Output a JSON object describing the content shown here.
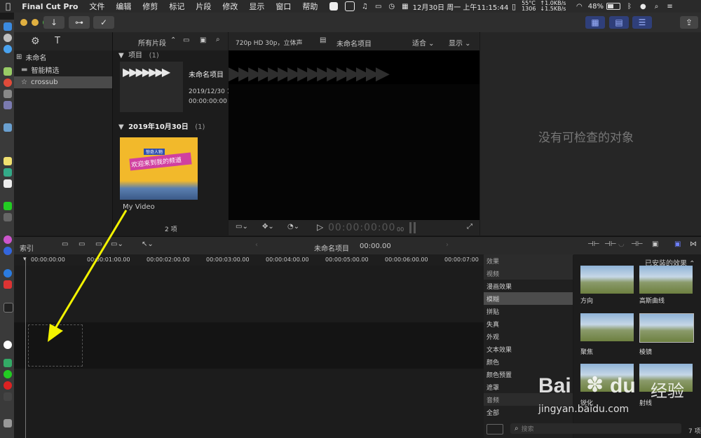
{
  "menubar": {
    "apple": "",
    "items": [
      "Final Cut Pro",
      "文件",
      "编辑",
      "修剪",
      "标记",
      "片段",
      "修改",
      "显示",
      "窗口",
      "帮助"
    ],
    "status": {
      "date": "12月30日 周一 上午11:15:44",
      "temp": "55°C",
      "fan": "1306",
      "up": "↑1.0KB/s",
      "down": "↓1.5KB/s",
      "battery": "48%"
    }
  },
  "browser": {
    "filter": "所有片段",
    "section1": "项目",
    "section1_count": "(1)",
    "project_name": "未命名项目",
    "project_date": "2019/12/30 11",
    "project_tc": "00:00:00:00",
    "section2": "2019年10月30日",
    "section2_count": "(1)",
    "clip_name": "My Video",
    "clip_banner": "欢迎来到我的频道",
    "clip_tag": "惊奇人物",
    "count": "2 项"
  },
  "library": {
    "items": [
      "未命名",
      "智能精选",
      "crossub"
    ]
  },
  "viewer": {
    "format": "720p HD 30p，立体声",
    "project": "未命名项目",
    "fit": "适合",
    "display": "显示",
    "timecode": "00:00:00:00",
    "frames": "00"
  },
  "inspector": {
    "empty": "没有可检查的对象"
  },
  "timeline": {
    "index": "索引",
    "project": "未命名项目",
    "time": "00:00.00",
    "ruler": [
      "00:00:00:00",
      "00:00:01:00.00",
      "00:00:02:00.00",
      "00:00:03:00.00",
      "00:00:04:00.00",
      "00:00:05:00.00",
      "00:00:06:00.00",
      "00:00:07:00"
    ]
  },
  "effects": {
    "header": "效果",
    "installed": "已安装的效果",
    "categories": [
      "视频",
      "漫画效果",
      "模糊",
      "拼贴",
      "失真",
      "外观",
      "文本效果",
      "颜色",
      "颜色预置",
      "遮罩",
      "音频",
      "全部"
    ],
    "selected": 2,
    "thumbs": [
      "方向",
      "高斯曲线",
      "聚焦",
      "棱镜",
      "锐化",
      "射线"
    ],
    "search_placeholder": "搜索",
    "count": "7 项"
  },
  "watermark": {
    "brand": "Bai",
    "brand2": "du",
    "cn": "经验",
    "url": "jingyan.baidu.com"
  },
  "colors": {
    "arrow": "#f2f200",
    "accent": "#2f3f7a"
  }
}
